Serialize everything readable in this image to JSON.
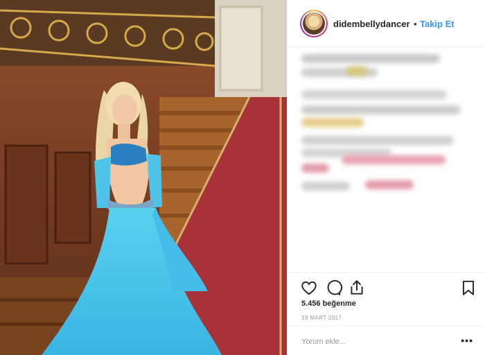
{
  "post": {
    "username": "didembellydancer",
    "separator": "•",
    "follow_label": "Takip Et",
    "likes": "5.456 beğenme",
    "date": "19 MART 2017",
    "comment_placeholder": "Yorum ekle...",
    "more_label": "•••"
  },
  "icons": {
    "like": "heart-icon",
    "comment": "comment-icon",
    "share": "share-icon",
    "save": "bookmark-icon"
  },
  "colors": {
    "link_blue": "#3897f0",
    "text": "#262626",
    "muted": "#999999",
    "dress": "#4fc3e8"
  }
}
